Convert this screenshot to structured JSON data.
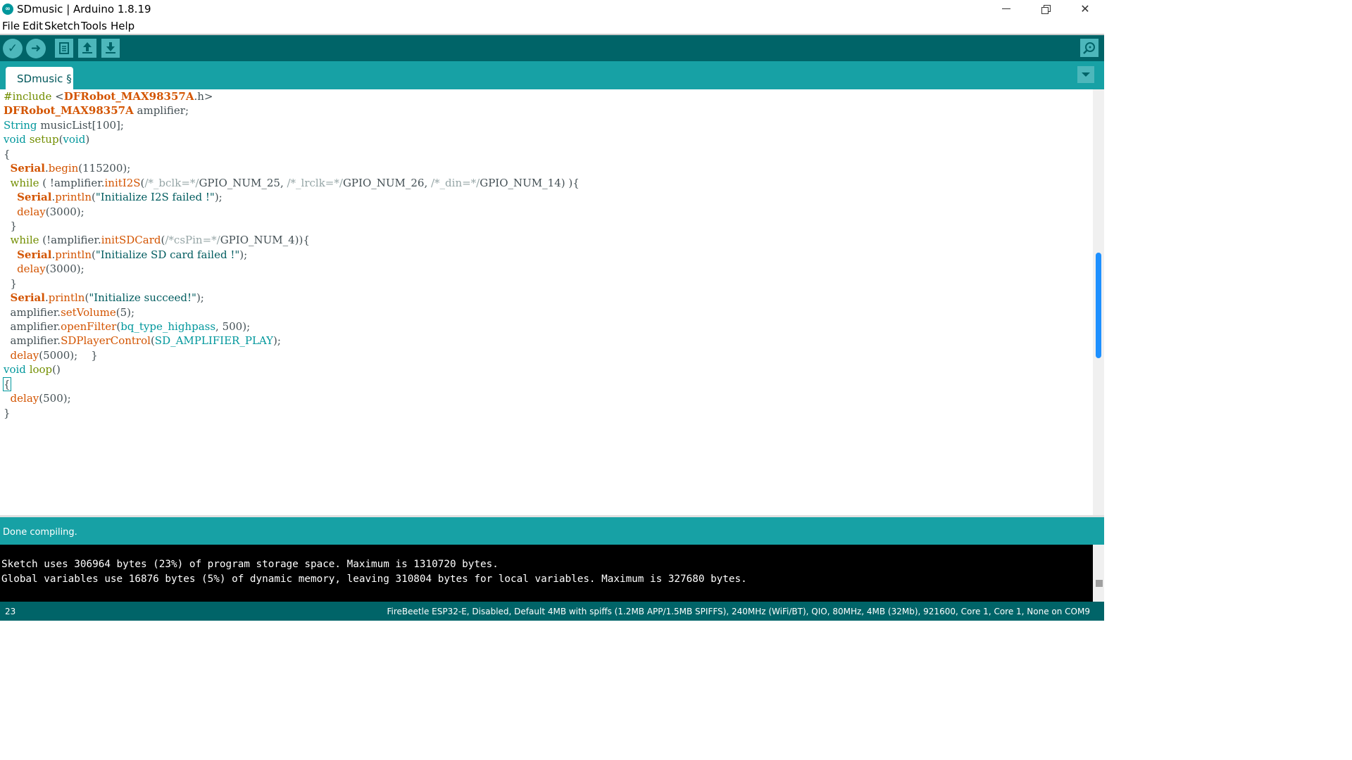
{
  "window": {
    "title": "SDmusic | Arduino 1.8.19",
    "logo_icon": "arduino-infinity-logo",
    "controls": [
      "minimize-icon",
      "maximize-icon",
      "close-icon"
    ]
  },
  "menu": {
    "items": [
      "File",
      "Edit",
      "Sketch",
      "Tools",
      "Help"
    ]
  },
  "toolbar": {
    "buttons": [
      "verify-icon",
      "upload-icon",
      "new-icon",
      "open-icon",
      "save-icon"
    ],
    "right_button": "serial-monitor-icon"
  },
  "tabs": [
    {
      "label": "SDmusic §",
      "active": true
    }
  ],
  "editor": {
    "language": "cpp",
    "lines": [
      [
        [
          "t-ctl",
          "#include "
        ],
        [
          "t-par",
          "<"
        ],
        [
          "t-cls",
          "DFRobot_MAX98357A"
        ],
        [
          "t-par",
          ".h>"
        ]
      ],
      [
        [
          "t-cls",
          "DFRobot_MAX98357A"
        ],
        [
          "t-par",
          " amplifier;"
        ]
      ],
      [
        [
          "t-kw",
          "String"
        ],
        [
          "t-par",
          " musicList[100];"
        ]
      ],
      [
        [
          "t-kw",
          "void"
        ],
        [
          "t-par",
          " "
        ],
        [
          "t-ctl",
          "setup"
        ],
        [
          "t-par",
          "("
        ],
        [
          "t-kw",
          "void"
        ],
        [
          "t-par",
          ")"
        ]
      ],
      [
        [
          "t-par",
          "{"
        ]
      ],
      [
        [
          "t-par",
          "  "
        ],
        [
          "t-cls",
          "Serial"
        ],
        [
          "t-par",
          "."
        ],
        [
          "t-fn",
          "begin"
        ],
        [
          "t-par",
          "(115200);"
        ]
      ],
      [
        [
          "t-par",
          "  "
        ],
        [
          "t-ctl",
          "while"
        ],
        [
          "t-par",
          " ( !amplifier."
        ],
        [
          "t-fn",
          "initI2S"
        ],
        [
          "t-par",
          "("
        ],
        [
          "t-com",
          "/*_bclk=*/"
        ],
        [
          "t-par",
          "GPIO_NUM_25, "
        ],
        [
          "t-com",
          "/*_lrclk=*/"
        ],
        [
          "t-par",
          "GPIO_NUM_26, "
        ],
        [
          "t-com",
          "/*_din=*/"
        ],
        [
          "t-par",
          "GPIO_NUM_14) ){"
        ]
      ],
      [
        [
          "t-par",
          "    "
        ],
        [
          "t-cls",
          "Serial"
        ],
        [
          "t-par",
          "."
        ],
        [
          "t-fn",
          "println"
        ],
        [
          "t-par",
          "("
        ],
        [
          "t-str",
          "\"Initialize I2S failed !\""
        ],
        [
          "t-par",
          ");"
        ]
      ],
      [
        [
          "t-par",
          "    "
        ],
        [
          "t-fn",
          "delay"
        ],
        [
          "t-par",
          "(3000);"
        ]
      ],
      [
        [
          "t-par",
          "  }"
        ]
      ],
      [
        [
          "t-par",
          "  "
        ],
        [
          "t-ctl",
          "while"
        ],
        [
          "t-par",
          " (!amplifier."
        ],
        [
          "t-fn",
          "initSDCard"
        ],
        [
          "t-par",
          "("
        ],
        [
          "t-com",
          "/*csPin=*/"
        ],
        [
          "t-par",
          "GPIO_NUM_4)){"
        ]
      ],
      [
        [
          "t-par",
          "    "
        ],
        [
          "t-cls",
          "Serial"
        ],
        [
          "t-par",
          "."
        ],
        [
          "t-fn",
          "println"
        ],
        [
          "t-par",
          "("
        ],
        [
          "t-str",
          "\"Initialize SD card failed !\""
        ],
        [
          "t-par",
          ");"
        ]
      ],
      [
        [
          "t-par",
          "    "
        ],
        [
          "t-fn",
          "delay"
        ],
        [
          "t-par",
          "(3000);"
        ]
      ],
      [
        [
          "t-par",
          "  }"
        ]
      ],
      [
        [
          "t-par",
          "  "
        ],
        [
          "t-cls",
          "Serial"
        ],
        [
          "t-par",
          "."
        ],
        [
          "t-fn",
          "println"
        ],
        [
          "t-par",
          "("
        ],
        [
          "t-str",
          "\"Initialize succeed!\""
        ],
        [
          "t-par",
          ");"
        ]
      ],
      [
        [
          "t-par",
          "  amplifier."
        ],
        [
          "t-fn",
          "setVolume"
        ],
        [
          "t-par",
          "(5);"
        ]
      ],
      [
        [
          "t-par",
          "  amplifier."
        ],
        [
          "t-fn",
          "openFilter"
        ],
        [
          "t-par",
          "("
        ],
        [
          "t-kw",
          "bq_type_highpass"
        ],
        [
          "t-par",
          ", 500);"
        ]
      ],
      [
        [
          "t-par",
          "  amplifier."
        ],
        [
          "t-fn",
          "SDPlayerControl"
        ],
        [
          "t-par",
          "("
        ],
        [
          "t-kw",
          "SD_AMPLIFIER_PLAY"
        ],
        [
          "t-par",
          ");"
        ]
      ],
      [
        [
          "t-par",
          "  "
        ],
        [
          "t-fn",
          "delay"
        ],
        [
          "t-par",
          "(5000);    }"
        ]
      ],
      [
        [
          "t-kw",
          "void"
        ],
        [
          "t-par",
          " "
        ],
        [
          "t-ctl",
          "loop"
        ],
        [
          "t-par",
          "()"
        ]
      ],
      [
        [
          "t-cursor",
          "{"
        ]
      ],
      [
        [
          "t-par",
          "  "
        ],
        [
          "t-fn",
          "delay"
        ],
        [
          "t-par",
          "(500);"
        ]
      ],
      [
        [
          "t-par",
          "}"
        ]
      ]
    ]
  },
  "status": {
    "message": "Done compiling."
  },
  "console": {
    "lines": [
      "Sketch uses 306964 bytes (23%) of program storage space. Maximum is 1310720 bytes.",
      "Global variables use 16876 bytes (5%) of dynamic memory, leaving 310804 bytes for local variables. Maximum is 327680 bytes."
    ]
  },
  "footer": {
    "line_number": "23",
    "board_info": "FireBeetle ESP32-E, Disabled, Default 4MB with spiffs (1.2MB APP/1.5MB SPIFFS), 240MHz (WiFi/BT), QIO, 80MHz, 4MB (32Mb), 921600, Core 1, Core 1, None on COM9"
  },
  "colors": {
    "toolbar_bg": "#006468",
    "tabs_bg": "#17a1a5",
    "keyword": "#00979c",
    "control": "#728e00",
    "class": "#d35400",
    "comment": "#95a5a6"
  }
}
